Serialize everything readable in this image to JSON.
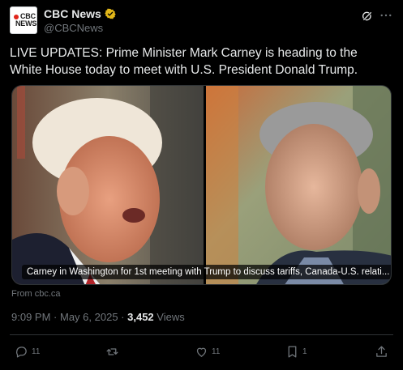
{
  "author": {
    "name": "CBC News",
    "handle": "@CBCNews",
    "avatar_logo": "CBC NEWS"
  },
  "post": {
    "text": "LIVE UPDATES: Prime Minister Mark Carney is heading to the White House today to meet with U.S. President Donald Trump.",
    "media_caption": "Carney in Washington for 1st meeting with Trump to discuss tariffs, Canada-U.S. relati...",
    "source": "From cbc.ca",
    "time": "9:09 PM",
    "date": "May 6, 2025",
    "views_count": "3,452",
    "views_label": "Views"
  },
  "actions": {
    "replies": "11",
    "reposts": "",
    "likes": "11",
    "bookmarks": "1"
  },
  "colors": {
    "background": "#000000",
    "text": "#e7e9ea",
    "muted": "#71767b",
    "verified": "#e2b719",
    "divider": "#2f3336"
  },
  "icons": [
    "grok-icon",
    "more-icon",
    "verified-badge-icon",
    "reply-icon",
    "repost-icon",
    "like-icon",
    "bookmark-icon",
    "share-icon"
  ]
}
